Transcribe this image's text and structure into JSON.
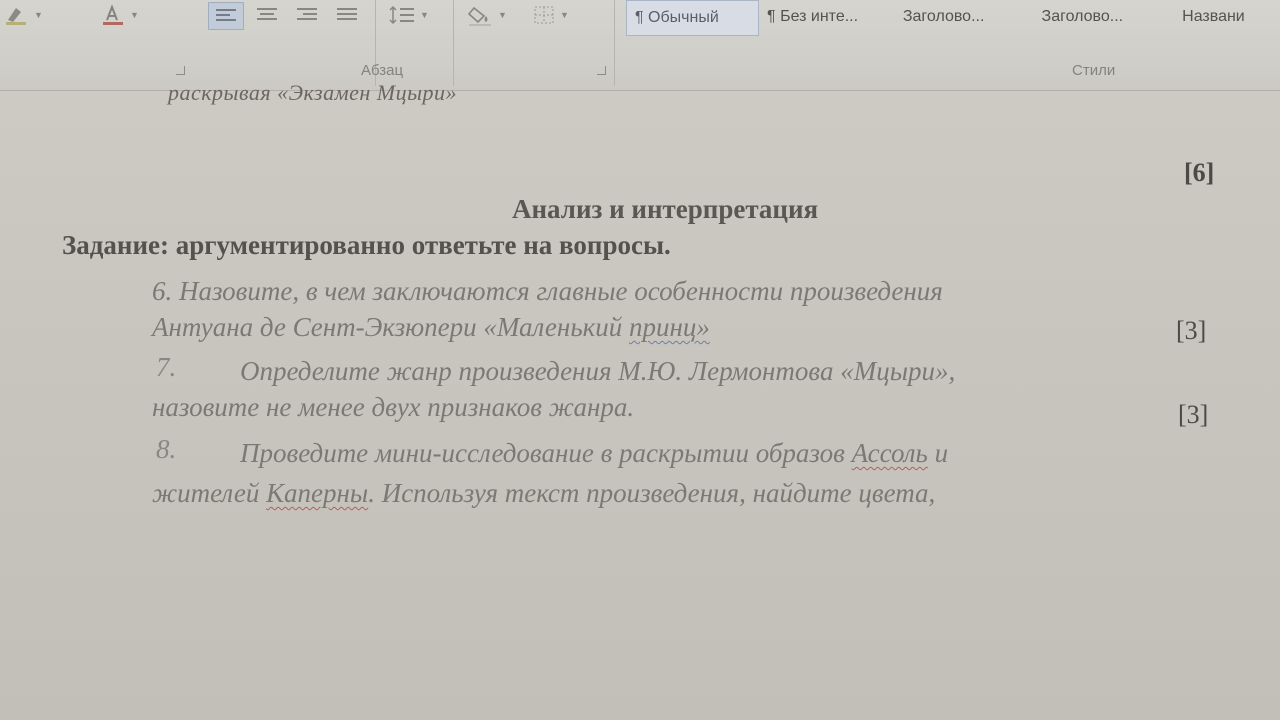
{
  "ribbon": {
    "paragraph_group_label": "Абзац",
    "styles_group_label": "Стили",
    "styles": [
      {
        "label": "¶ Обычный",
        "selected": true
      },
      {
        "label": "¶ Без инте...",
        "selected": false
      },
      {
        "label": "Заголово...",
        "selected": false
      },
      {
        "label": "Заголово...",
        "selected": false
      },
      {
        "label": "Названи",
        "selected": false
      }
    ],
    "tools": [
      {
        "name": "highlight-color",
        "icon": "highlighter-icon"
      },
      {
        "name": "font-color",
        "icon": "font-color-icon"
      },
      {
        "name": "align-left",
        "icon": "align-left-icon",
        "active": true
      },
      {
        "name": "align-center",
        "icon": "align-center-icon"
      },
      {
        "name": "align-right",
        "icon": "align-right-icon"
      },
      {
        "name": "justify",
        "icon": "justify-icon"
      },
      {
        "name": "line-spacing",
        "icon": "line-spacing-icon"
      },
      {
        "name": "shading",
        "icon": "paint-bucket-icon"
      },
      {
        "name": "borders",
        "icon": "borders-icon"
      }
    ],
    "accent_color": "#c2ccd8"
  },
  "document": {
    "cut_line": "раскрывая «Экзамен Мцыри»",
    "prev_score": "[6]",
    "section_heading": "Анализ и интерпретация",
    "task_heading": "Задание: аргументированно ответьте на вопросы.",
    "q6": {
      "line1": "6. Назовите, в чем заключаются главные особенности произведения",
      "line2_a": "Антуана де Сент-Экзюпери «Маленький ",
      "line2_b": "принц»",
      "score": "[3]"
    },
    "q7": {
      "num": "7.",
      "line1": "Определите жанр произведения М.Ю. Лермонтова «Мцыри»,",
      "line2": "назовите не менее двух признаков жанра.",
      "score": "[3]"
    },
    "q8": {
      "num": "8.",
      "line1_a": "Проведите мини-исследование в раскрытии образов ",
      "line1_b": "Ассоль",
      "line1_c": " и",
      "line2_a": "жителей ",
      "line2_b": "Каперны",
      "line2_c": ". Используя текст произведения, найдите цвета,"
    }
  }
}
